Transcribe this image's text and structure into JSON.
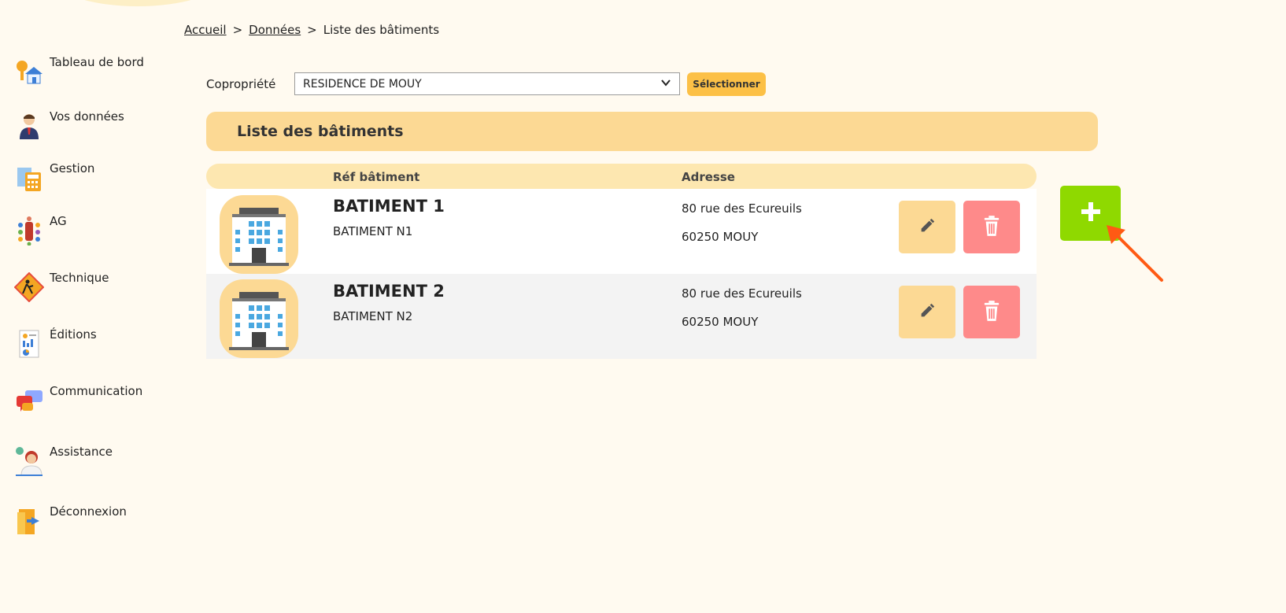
{
  "breadcrumb": {
    "home": "Accueil",
    "data": "Données",
    "current": "Liste des bâtiments",
    "separator": ">"
  },
  "sidebar": {
    "items": [
      {
        "label": "Tableau de bord",
        "icon": "dashboard-keys-house-icon"
      },
      {
        "label": "Vos données",
        "icon": "user-avatar-icon"
      },
      {
        "label": "Gestion",
        "icon": "calculator-document-icon"
      },
      {
        "label": "AG",
        "icon": "meeting-table-icon"
      },
      {
        "label": "Technique",
        "icon": "worker-sign-icon"
      },
      {
        "label": "Éditions",
        "icon": "report-document-icon"
      },
      {
        "label": "Communication",
        "icon": "chat-bubbles-icon"
      },
      {
        "label": "Assistance",
        "icon": "support-agent-icon"
      },
      {
        "label": "Déconnexion",
        "icon": "logout-door-icon"
      }
    ]
  },
  "filter": {
    "label": "Copropriété",
    "selected": "RESIDENCE DE MOUY",
    "button": "Sélectionner"
  },
  "section": {
    "title": "Liste des bâtiments"
  },
  "table": {
    "headers": {
      "ref": "Réf bâtiment",
      "address": "Adresse"
    },
    "rows": [
      {
        "title": "BATIMENT 1",
        "subtitle": "BATIMENT N1",
        "address_line1": "80 rue des Ecureuils",
        "address_line2": "60250 MOUY"
      },
      {
        "title": "BATIMENT 2",
        "subtitle": "BATIMENT N2",
        "address_line1": "80 rue des Ecureuils",
        "address_line2": "60250 MOUY"
      }
    ]
  },
  "colors": {
    "page_bg": "#fffaf0",
    "accent_yellow": "#fcc046",
    "header_band": "#fcd994",
    "table_head": "#fde7b0",
    "edit": "#fcd994",
    "delete": "#fe8a8a",
    "add": "#8fd900",
    "arrow": "#ff5a14"
  },
  "actions": {
    "edit_icon": "pencil-icon",
    "delete_icon": "trash-icon",
    "add_icon": "plus-icon"
  }
}
